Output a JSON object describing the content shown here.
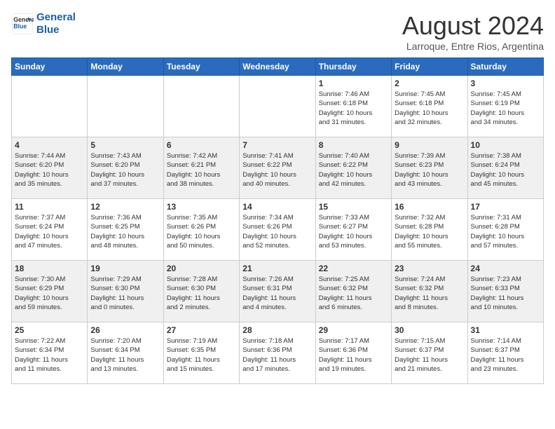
{
  "header": {
    "logo_line1": "General",
    "logo_line2": "Blue",
    "month_title": "August 2024",
    "subtitle": "Larroque, Entre Rios, Argentina"
  },
  "days_of_week": [
    "Sunday",
    "Monday",
    "Tuesday",
    "Wednesday",
    "Thursday",
    "Friday",
    "Saturday"
  ],
  "weeks": [
    [
      {
        "day": "",
        "info": ""
      },
      {
        "day": "",
        "info": ""
      },
      {
        "day": "",
        "info": ""
      },
      {
        "day": "",
        "info": ""
      },
      {
        "day": "1",
        "info": "Sunrise: 7:46 AM\nSunset: 6:18 PM\nDaylight: 10 hours\nand 31 minutes."
      },
      {
        "day": "2",
        "info": "Sunrise: 7:45 AM\nSunset: 6:18 PM\nDaylight: 10 hours\nand 32 minutes."
      },
      {
        "day": "3",
        "info": "Sunrise: 7:45 AM\nSunset: 6:19 PM\nDaylight: 10 hours\nand 34 minutes."
      }
    ],
    [
      {
        "day": "4",
        "info": "Sunrise: 7:44 AM\nSunset: 6:20 PM\nDaylight: 10 hours\nand 35 minutes."
      },
      {
        "day": "5",
        "info": "Sunrise: 7:43 AM\nSunset: 6:20 PM\nDaylight: 10 hours\nand 37 minutes."
      },
      {
        "day": "6",
        "info": "Sunrise: 7:42 AM\nSunset: 6:21 PM\nDaylight: 10 hours\nand 38 minutes."
      },
      {
        "day": "7",
        "info": "Sunrise: 7:41 AM\nSunset: 6:22 PM\nDaylight: 10 hours\nand 40 minutes."
      },
      {
        "day": "8",
        "info": "Sunrise: 7:40 AM\nSunset: 6:22 PM\nDaylight: 10 hours\nand 42 minutes."
      },
      {
        "day": "9",
        "info": "Sunrise: 7:39 AM\nSunset: 6:23 PM\nDaylight: 10 hours\nand 43 minutes."
      },
      {
        "day": "10",
        "info": "Sunrise: 7:38 AM\nSunset: 6:24 PM\nDaylight: 10 hours\nand 45 minutes."
      }
    ],
    [
      {
        "day": "11",
        "info": "Sunrise: 7:37 AM\nSunset: 6:24 PM\nDaylight: 10 hours\nand 47 minutes."
      },
      {
        "day": "12",
        "info": "Sunrise: 7:36 AM\nSunset: 6:25 PM\nDaylight: 10 hours\nand 48 minutes."
      },
      {
        "day": "13",
        "info": "Sunrise: 7:35 AM\nSunset: 6:26 PM\nDaylight: 10 hours\nand 50 minutes."
      },
      {
        "day": "14",
        "info": "Sunrise: 7:34 AM\nSunset: 6:26 PM\nDaylight: 10 hours\nand 52 minutes."
      },
      {
        "day": "15",
        "info": "Sunrise: 7:33 AM\nSunset: 6:27 PM\nDaylight: 10 hours\nand 53 minutes."
      },
      {
        "day": "16",
        "info": "Sunrise: 7:32 AM\nSunset: 6:28 PM\nDaylight: 10 hours\nand 55 minutes."
      },
      {
        "day": "17",
        "info": "Sunrise: 7:31 AM\nSunset: 6:28 PM\nDaylight: 10 hours\nand 57 minutes."
      }
    ],
    [
      {
        "day": "18",
        "info": "Sunrise: 7:30 AM\nSunset: 6:29 PM\nDaylight: 10 hours\nand 59 minutes."
      },
      {
        "day": "19",
        "info": "Sunrise: 7:29 AM\nSunset: 6:30 PM\nDaylight: 11 hours\nand 0 minutes."
      },
      {
        "day": "20",
        "info": "Sunrise: 7:28 AM\nSunset: 6:30 PM\nDaylight: 11 hours\nand 2 minutes."
      },
      {
        "day": "21",
        "info": "Sunrise: 7:26 AM\nSunset: 6:31 PM\nDaylight: 11 hours\nand 4 minutes."
      },
      {
        "day": "22",
        "info": "Sunrise: 7:25 AM\nSunset: 6:32 PM\nDaylight: 11 hours\nand 6 minutes."
      },
      {
        "day": "23",
        "info": "Sunrise: 7:24 AM\nSunset: 6:32 PM\nDaylight: 11 hours\nand 8 minutes."
      },
      {
        "day": "24",
        "info": "Sunrise: 7:23 AM\nSunset: 6:33 PM\nDaylight: 11 hours\nand 10 minutes."
      }
    ],
    [
      {
        "day": "25",
        "info": "Sunrise: 7:22 AM\nSunset: 6:34 PM\nDaylight: 11 hours\nand 11 minutes."
      },
      {
        "day": "26",
        "info": "Sunrise: 7:20 AM\nSunset: 6:34 PM\nDaylight: 11 hours\nand 13 minutes."
      },
      {
        "day": "27",
        "info": "Sunrise: 7:19 AM\nSunset: 6:35 PM\nDaylight: 11 hours\nand 15 minutes."
      },
      {
        "day": "28",
        "info": "Sunrise: 7:18 AM\nSunset: 6:36 PM\nDaylight: 11 hours\nand 17 minutes."
      },
      {
        "day": "29",
        "info": "Sunrise: 7:17 AM\nSunset: 6:36 PM\nDaylight: 11 hours\nand 19 minutes."
      },
      {
        "day": "30",
        "info": "Sunrise: 7:15 AM\nSunset: 6:37 PM\nDaylight: 11 hours\nand 21 minutes."
      },
      {
        "day": "31",
        "info": "Sunrise: 7:14 AM\nSunset: 6:37 PM\nDaylight: 11 hours\nand 23 minutes."
      }
    ]
  ]
}
